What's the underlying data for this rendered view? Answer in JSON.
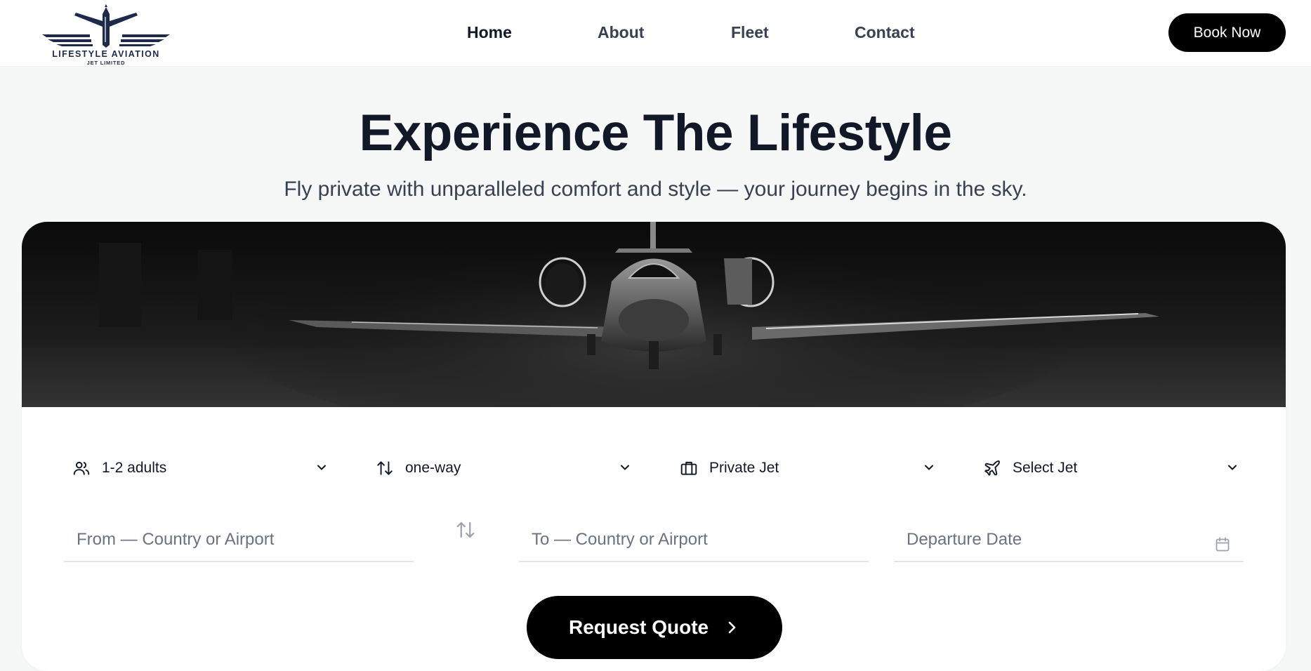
{
  "header": {
    "logo": {
      "name": "LIFESTYLE AVIATION",
      "subtitle": "JET LIMITED",
      "icon": "jet-wings-logo"
    },
    "nav": [
      {
        "label": "Home",
        "active": true
      },
      {
        "label": "About",
        "active": false
      },
      {
        "label": "Fleet",
        "active": false
      },
      {
        "label": "Contact",
        "active": false
      }
    ],
    "cta_label": "Book Now"
  },
  "hero": {
    "title": "Experience The Lifestyle",
    "subtitle": "Fly private with unparalleled comfort and style — your journey begins in the sky.",
    "image": "private-jet-hangar-photo"
  },
  "booking": {
    "dropdowns": [
      {
        "icon": "users-icon",
        "value": "1-2 adults"
      },
      {
        "icon": "arrows-up-down-icon",
        "value": "one-way"
      },
      {
        "icon": "briefcase-icon",
        "value": "Private Jet"
      },
      {
        "icon": "plane-icon",
        "value": "Select Jet"
      }
    ],
    "from_placeholder": "From — Country or Airport",
    "to_placeholder": "To — Country or Airport",
    "date_placeholder": "Departure Date",
    "submit_label": "Request Quote"
  },
  "colors": {
    "page_bg": "#f6f7f7",
    "primary_button": "#000000",
    "heading": "#111827",
    "logo_navy": "#1e2a4a"
  }
}
